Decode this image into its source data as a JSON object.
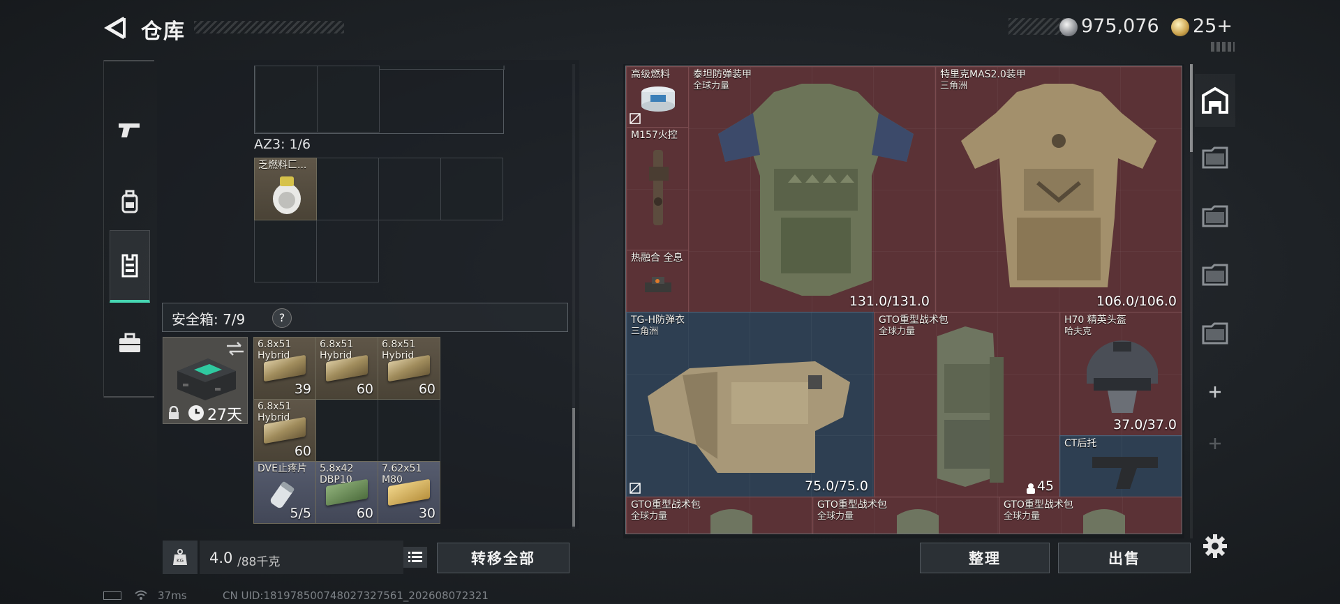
{
  "header": {
    "title": "仓库",
    "silver_amount": "975,076",
    "gold_amount": "25+"
  },
  "left_tabs": [
    {
      "name": "weapons",
      "icon": "pistol-icon"
    },
    {
      "name": "backpack",
      "icon": "backpack-icon"
    },
    {
      "name": "vest",
      "icon": "vest-icon",
      "active": true
    },
    {
      "name": "case",
      "icon": "briefcase-icon"
    }
  ],
  "inventory": {
    "section_az3": "AZ3: 1/6",
    "az3_item": {
      "name": "乏燃料匚..."
    },
    "safe_box": {
      "label": "安全箱: 7/9",
      "help": "?",
      "days": "27天"
    },
    "safe_items": [
      {
        "name": "6.8x51\nHybrid",
        "count": "39"
      },
      {
        "name": "6.8x51\nHybrid",
        "count": "60"
      },
      {
        "name": "6.8x51\nHybrid",
        "count": "60"
      },
      {
        "name": "6.8x51\nHybrid",
        "count": "60"
      },
      {
        "name": "DVE止疼片",
        "count": "5/5"
      },
      {
        "name": "5.8x42\nDBP10",
        "count": "60"
      },
      {
        "name": "7.62x51\nM80",
        "count": "30"
      }
    ],
    "weight": {
      "value": "4.0",
      "unit": "/88千克"
    },
    "transfer_all": "转移全部"
  },
  "stash": {
    "items": [
      {
        "name": "高级燃料",
        "sub": "",
        "dur": ""
      },
      {
        "name": "M157火控",
        "sub": "",
        "dur": ""
      },
      {
        "name": "热融合 全息",
        "sub": "",
        "dur": ""
      },
      {
        "name": "泰坦防弹装甲",
        "sub": "全球力量",
        "dur": "131.0/131.0"
      },
      {
        "name": "特里克MAS2.0装甲",
        "sub": "三角洲",
        "dur": "106.0/106.0"
      },
      {
        "name": "TG-H防弹衣",
        "sub": "三角洲",
        "dur": "75.0/75.0"
      },
      {
        "name": "GTO重型战术包",
        "sub": "全球力量",
        "dur": "45"
      },
      {
        "name": "H70 精英头盔",
        "sub": "哈夫克",
        "dur": "37.0/37.0"
      },
      {
        "name": "CT后托",
        "sub": "",
        "dur": ""
      },
      {
        "name": "GTO重型战术包",
        "sub": "全球力量",
        "dur": ""
      },
      {
        "name": "GTO重型战术包",
        "sub": "全球力量",
        "dur": ""
      },
      {
        "name": "GTO重型战术包",
        "sub": "全球力量",
        "dur": ""
      }
    ],
    "sort_label": "整理",
    "sell_label": "出售"
  },
  "status": {
    "ping": "37ms",
    "uid": "CN UID:18197850074802732756​1_202608072321"
  },
  "colors": {
    "accent": "#46d6b2",
    "rare_red": "#5b3236",
    "blue": "#2e3f52"
  }
}
